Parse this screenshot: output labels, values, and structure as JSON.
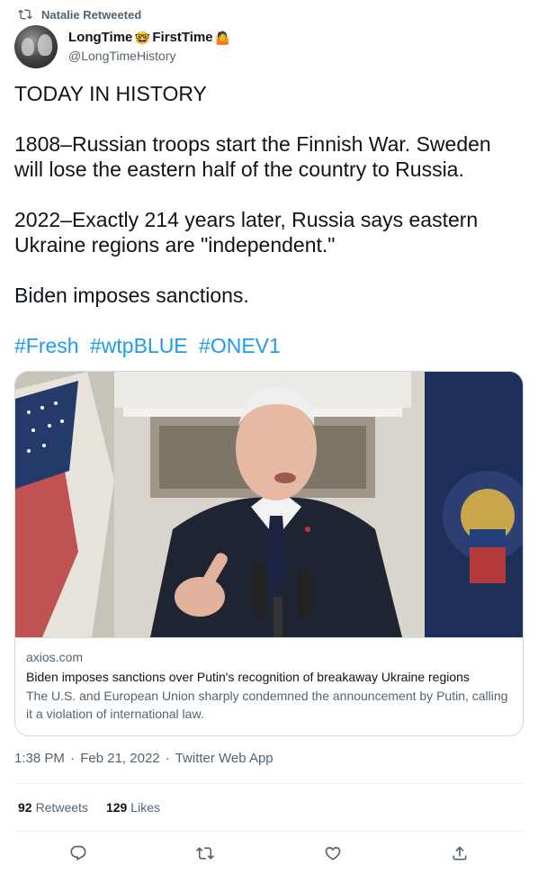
{
  "retweet": {
    "text": "Natalie Retweeted",
    "icon": "retweet-icon"
  },
  "author": {
    "name_part1": "LongTime",
    "emoji1": "🤓",
    "name_part2": "FirstTime",
    "emoji2": "🤷",
    "handle": "@LongTimeHistory"
  },
  "tweet": {
    "paragraphs": [
      "TODAY IN HISTORY",
      "1808–Russian troops start the Finnish War. Sweden will lose the eastern half of the country to Russia.",
      "2022–Exactly 214 years later, Russia says eastern Ukraine regions are \"independent.\"",
      "Biden imposes sanctions."
    ],
    "hashtags": [
      "#Fresh",
      "#wtpBLUE",
      "#ONEV1"
    ]
  },
  "card": {
    "domain": "axios.com",
    "title": "Biden imposes sanctions over Putin's recognition of breakaway Ukraine regions",
    "description": "The U.S. and European Union sharply condemned the announcement by Putin, calling it a violation of international law."
  },
  "meta": {
    "time": "1:38 PM",
    "separator": "·",
    "date": "Feb 21, 2022",
    "source": "Twitter Web App"
  },
  "stats": {
    "retweets_count": "92",
    "retweets_label": "Retweets",
    "likes_count": "129",
    "likes_label": "Likes"
  },
  "actions": [
    "reply-icon",
    "retweet-icon",
    "like-icon",
    "share-icon"
  ],
  "colors": {
    "link": "#1d9bf0",
    "muted": "#536471",
    "text": "#0f1419",
    "border": "#cfd9de"
  }
}
